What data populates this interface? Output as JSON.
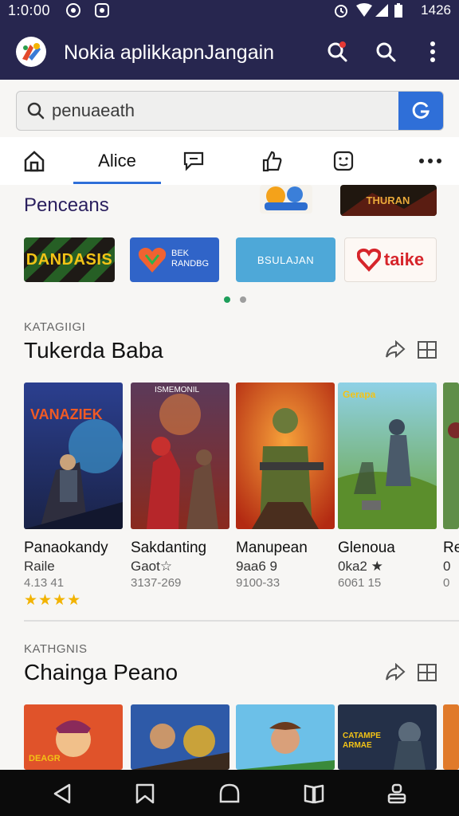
{
  "status_bar": {
    "time": "1:0:00",
    "right_text": "1426"
  },
  "app_bar": {
    "title": "Nokia aplikkapnJangain"
  },
  "search": {
    "placeholder": "penuaeath"
  },
  "tabs": {
    "active_label": "Alice"
  },
  "featured": {
    "title": "Penceans",
    "banners": [
      "DANDASIS",
      "BEK RANDBG",
      "BSULAJAN",
      "taike"
    ]
  },
  "section1": {
    "category": "KATAGIIGI",
    "title": "Tukerda Baba",
    "cards": [
      {
        "art_text": "VANAZIEK",
        "name": "Panaokandy",
        "sub": "Raile",
        "meta": "4.13 41",
        "stars": "★★★★"
      },
      {
        "art_text": "ISMEMONIL",
        "name": "Sakdanting",
        "sub": "Gaot☆",
        "meta": "3137-269",
        "stars": ""
      },
      {
        "art_text": "",
        "name": "Manupean",
        "sub": "9aa6 9",
        "meta": "9100-33",
        "stars": ""
      },
      {
        "art_text": "Gerapa",
        "name": "Glenoua",
        "sub": "0ka2 ★",
        "meta": "6061 15",
        "stars": ""
      },
      {
        "art_text": "",
        "name": "Re",
        "sub": "0",
        "meta": "0",
        "stars": ""
      }
    ]
  },
  "section2": {
    "category": "KATHGNIS",
    "title": "Chainga Peano",
    "cards": [
      {
        "art_text": "DEAGR"
      },
      {
        "art_text": ""
      },
      {
        "art_text": ""
      },
      {
        "art_text": "CATAMPE ARMAE"
      },
      {
        "art_text": ""
      }
    ]
  },
  "colors": {
    "app_bar": "#27264f",
    "accent": "#2f6fd8",
    "star": "#f2b300",
    "dot_active": "#1e9e5a"
  }
}
